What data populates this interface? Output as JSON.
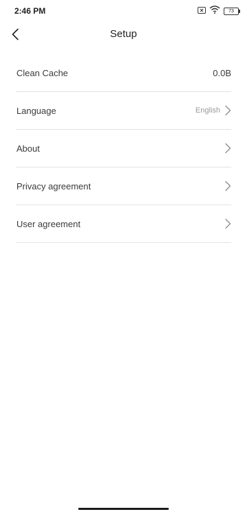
{
  "status_bar": {
    "time": "2:46 PM",
    "battery": "73",
    "icons": [
      "sim-off-icon",
      "wifi-icon",
      "battery-icon"
    ]
  },
  "header": {
    "title": "Setup",
    "back_icon": "chevron-left-icon"
  },
  "settings": {
    "clean_cache": {
      "label": "Clean Cache",
      "value": "0.0B"
    },
    "language": {
      "label": "Language",
      "value": "English"
    },
    "about": {
      "label": "About"
    },
    "privacy": {
      "label": "Privacy agreement"
    },
    "user": {
      "label": "User agreement"
    }
  }
}
